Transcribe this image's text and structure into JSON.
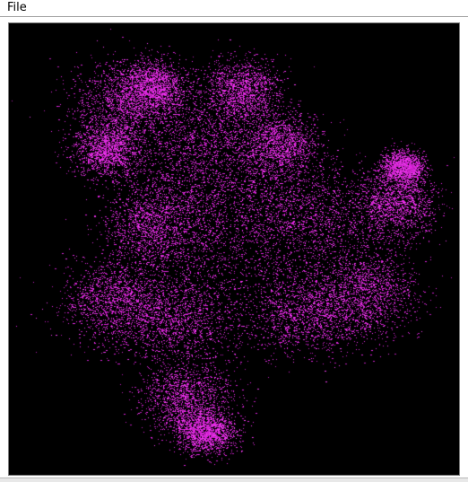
{
  "menubar": {
    "items": [
      {
        "label": "File"
      }
    ]
  },
  "canvas": {
    "content": "fractal-point-cloud",
    "background_color": "#000000",
    "point_color": "#e020e0"
  }
}
